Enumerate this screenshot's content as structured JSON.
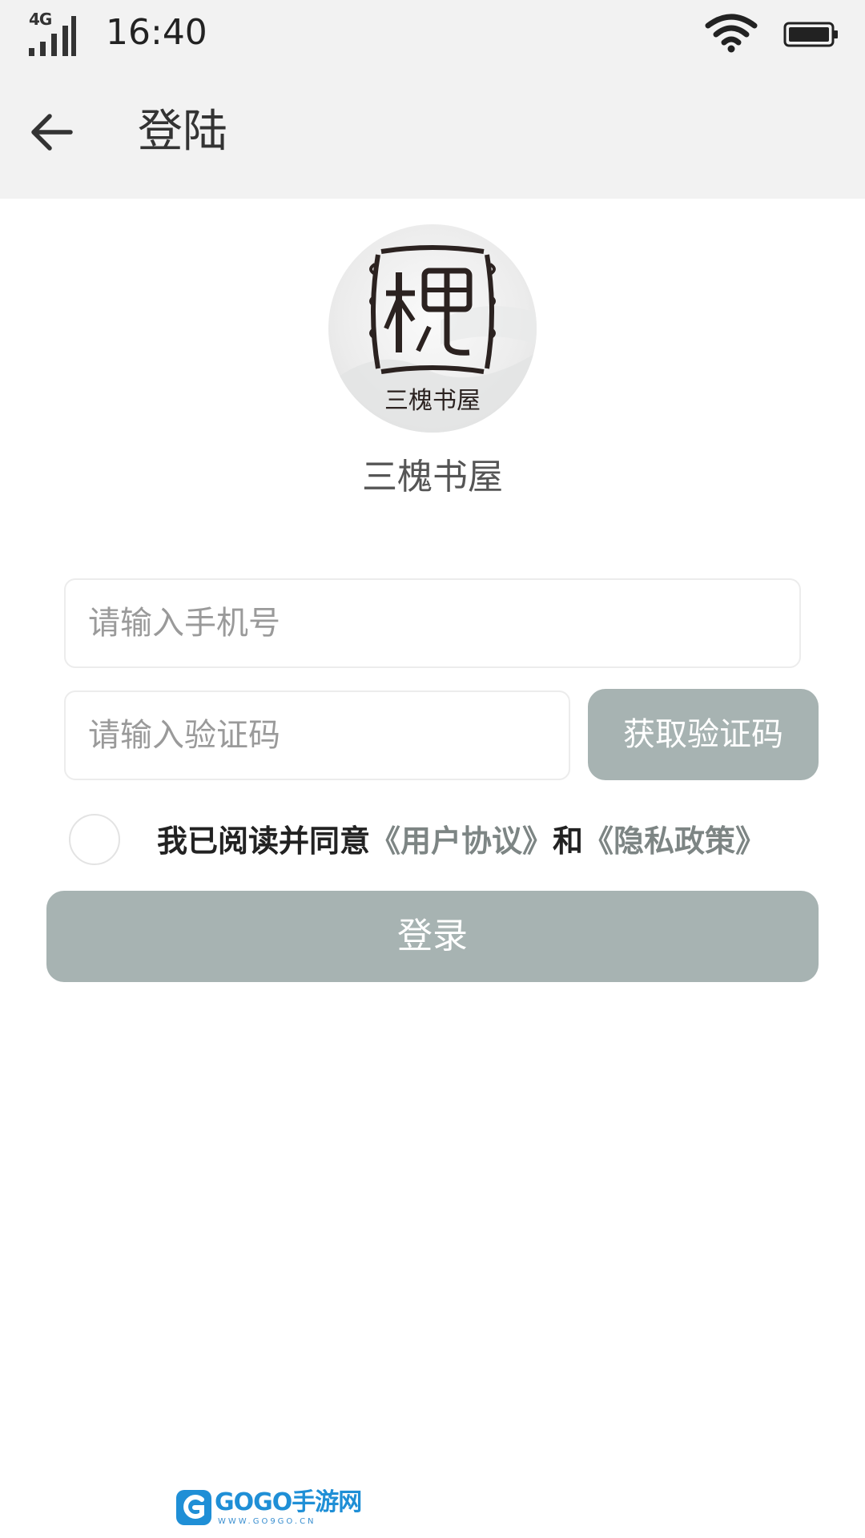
{
  "status_bar": {
    "network": "4G",
    "time": "16:40",
    "icons": [
      "signal-icon",
      "wifi-icon",
      "battery-icon"
    ]
  },
  "app_bar": {
    "back_icon": "arrow-left-icon",
    "title": "登陆"
  },
  "brand": {
    "logo_text": "三槐书屋",
    "name": "三槐书屋"
  },
  "form": {
    "phone": {
      "placeholder": "请输入手机号",
      "value": ""
    },
    "code": {
      "placeholder": "请输入验证码",
      "value": ""
    },
    "get_code_label": "获取验证码",
    "agreement": {
      "checked": false,
      "prefix": "我已阅读并同意",
      "user_agreement": "《用户协议》",
      "conjunction": "和",
      "privacy_policy": "《隐私政策》"
    },
    "login_label": "登录"
  },
  "watermark": {
    "text": "GOGO手游网",
    "sub": "WWW.GO9GO.CN"
  },
  "colors": {
    "bar_background": "#f2f2f2",
    "button_disabled": "#a7b3b2",
    "link": "#7d8584",
    "watermark": "#1f8fd6"
  }
}
